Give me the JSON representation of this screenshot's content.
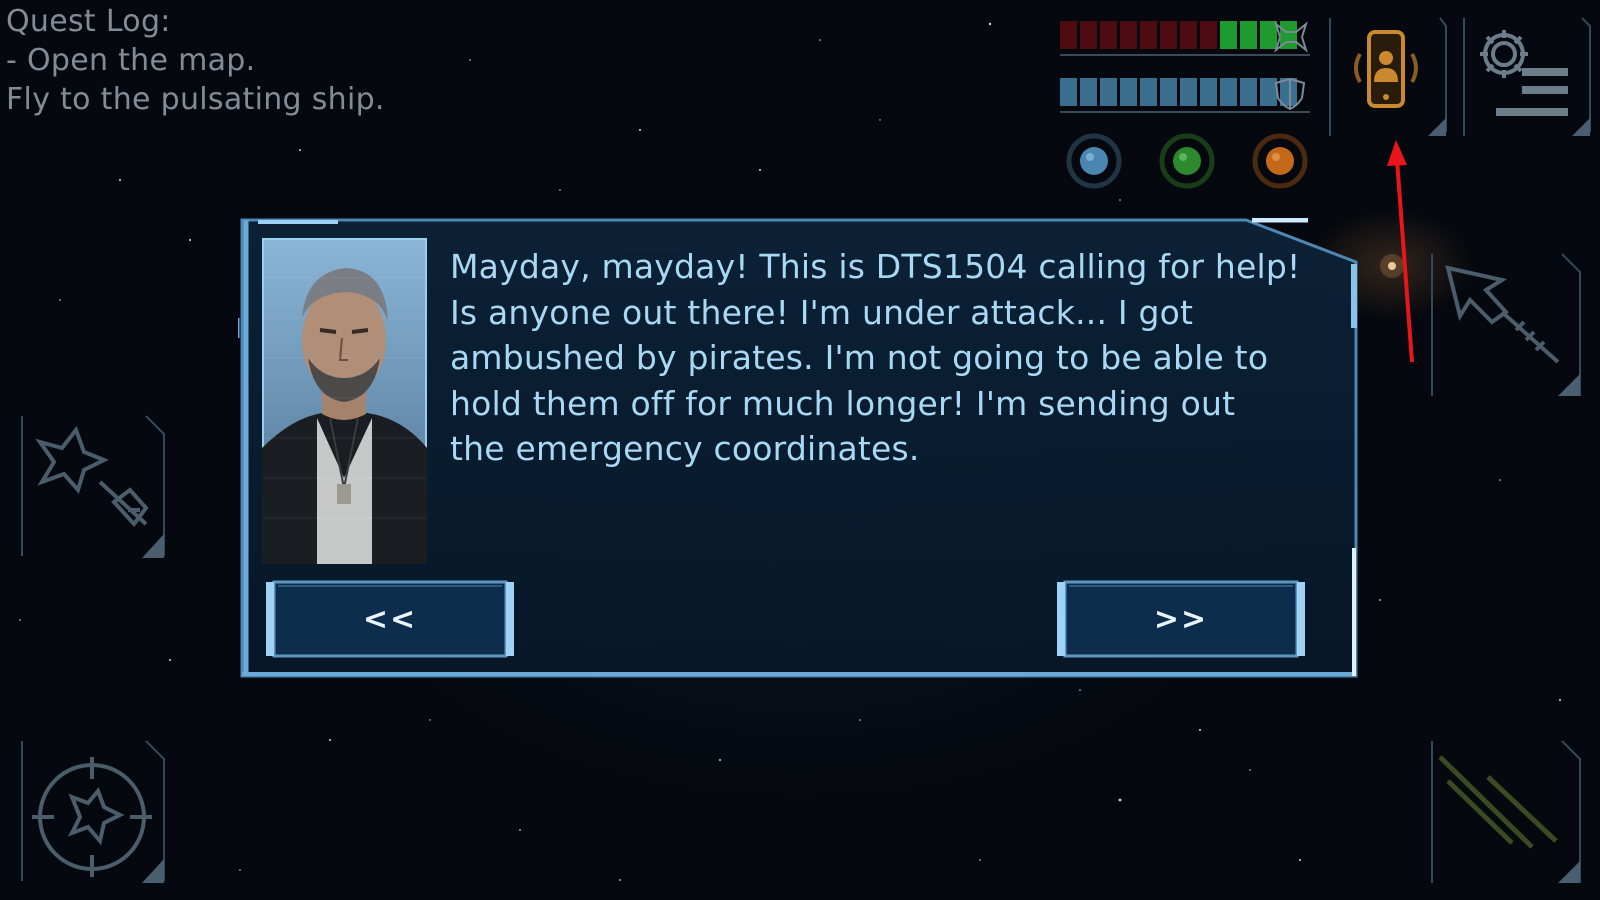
{
  "quest_log": {
    "title": "Quest Log:",
    "lines": [
      "- Open the map.",
      "Fly to the pulsating ship."
    ]
  },
  "hud": {
    "hull_bar": {
      "segments_total": 12,
      "segments_filled": 4,
      "filled_color": "#1f9a2e",
      "empty_color": "#5a0d12",
      "icon": "ship-hull-icon"
    },
    "shield_bar": {
      "segments_total": 12,
      "segments_filled": 12,
      "filled_color": "#3a6f8f",
      "icon": "shield-icon"
    },
    "orbs": [
      {
        "name": "blue-orb-indicator",
        "color": "#4a86b0"
      },
      {
        "name": "green-orb-indicator",
        "color": "#2c8a2c"
      },
      {
        "name": "orange-orb-indicator",
        "color": "#c26a18"
      }
    ],
    "buttons": [
      {
        "name": "communicator-phone-button",
        "icon": "phone-contact-icon",
        "accent": "#c9892c"
      },
      {
        "name": "settings-button",
        "icon": "gear-icon"
      }
    ]
  },
  "dialog": {
    "message_lines": [
      "Mayday, mayday! This is DTS1504 calling for help!",
      "Is anyone out there! I'm under attack... I got",
      "ambushed by pirates. I'm not going to be able to",
      "hold them off for much longer! I'm sending out",
      "the emergency coordinates."
    ],
    "prev_label": "<<",
    "next_label": ">>",
    "portrait": "bearded-pilot-portrait"
  },
  "side_controls": [
    {
      "name": "weapon-fire-button",
      "icon": "ship-weapon-icon"
    },
    {
      "name": "target-lock-button",
      "icon": "crosshair-ship-icon"
    },
    {
      "name": "missile-launch-button",
      "icon": "missile-ship-icon"
    },
    {
      "name": "boost-button",
      "icon": "speed-lines-icon"
    }
  ],
  "annotation": {
    "type": "red-arrow",
    "color": "#e8161b"
  }
}
